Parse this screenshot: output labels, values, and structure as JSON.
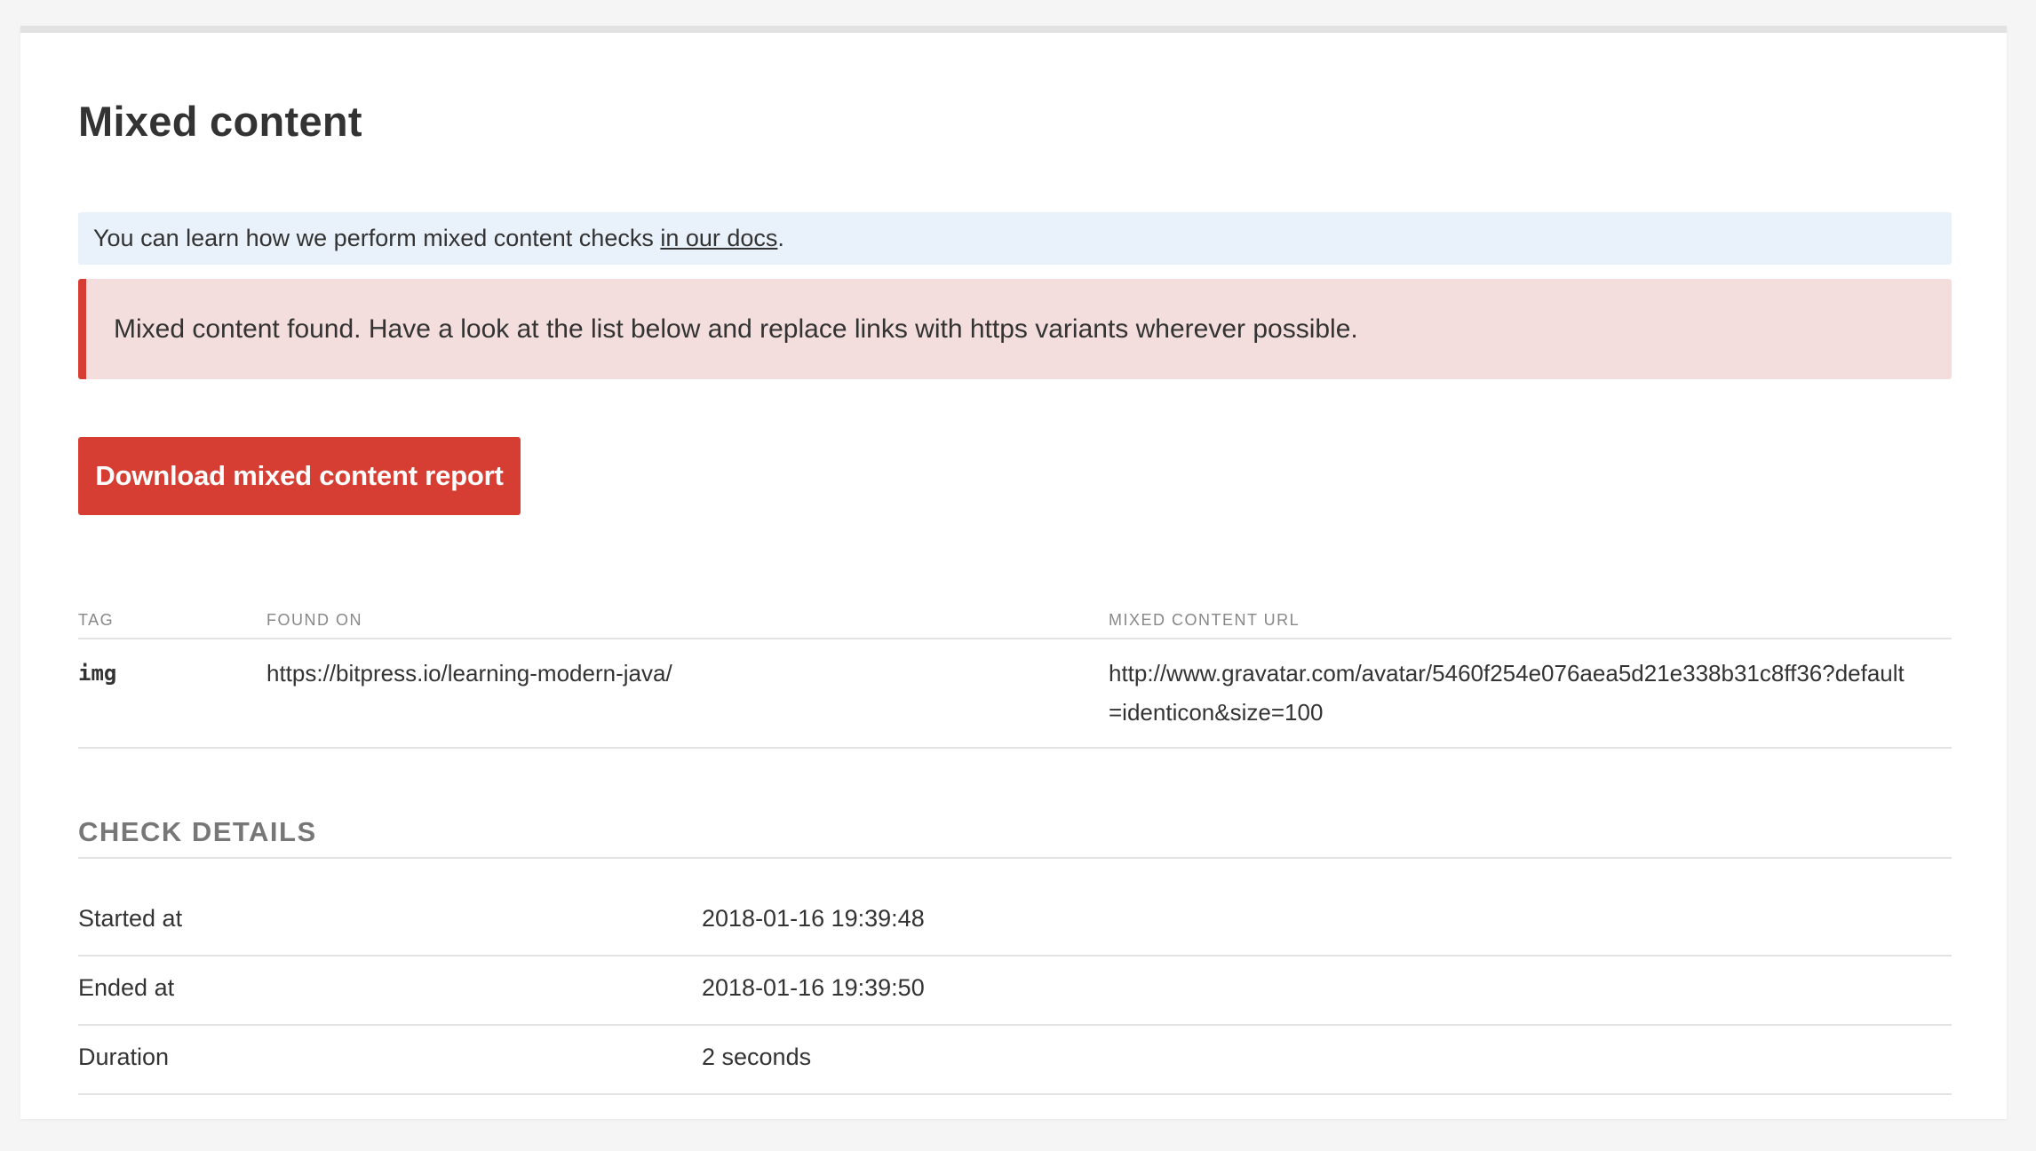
{
  "page": {
    "title": "Mixed content"
  },
  "info": {
    "text": "You can learn how we perform mixed content checks ",
    "link_text": "in our docs",
    "suffix": "."
  },
  "alert": {
    "message": "Mixed content found. Have a look at the list below and replace links with https variants wherever possible."
  },
  "actions": {
    "download_label": "Download mixed content report"
  },
  "table": {
    "headers": {
      "tag": "TAG",
      "found_on": "FOUND ON",
      "url": "MIXED CONTENT URL"
    },
    "rows": [
      {
        "tag": "img",
        "found_on": "https://bitpress.io/learning-modern-java/",
        "url": "http://www.gravatar.com/avatar/5460f254e076aea5d21e338b31c8ff36?default=identicon&size=100"
      }
    ]
  },
  "details": {
    "title": "CHECK DETAILS",
    "rows": [
      {
        "label": "Started at",
        "value": "2018-01-16 19:39:48"
      },
      {
        "label": "Ended at",
        "value": "2018-01-16 19:39:50"
      },
      {
        "label": "Duration",
        "value": "2 seconds"
      }
    ]
  },
  "colors": {
    "accent": "#d63e34",
    "info_bg": "#e9f1fb",
    "alert_bg": "#f3dedd"
  }
}
